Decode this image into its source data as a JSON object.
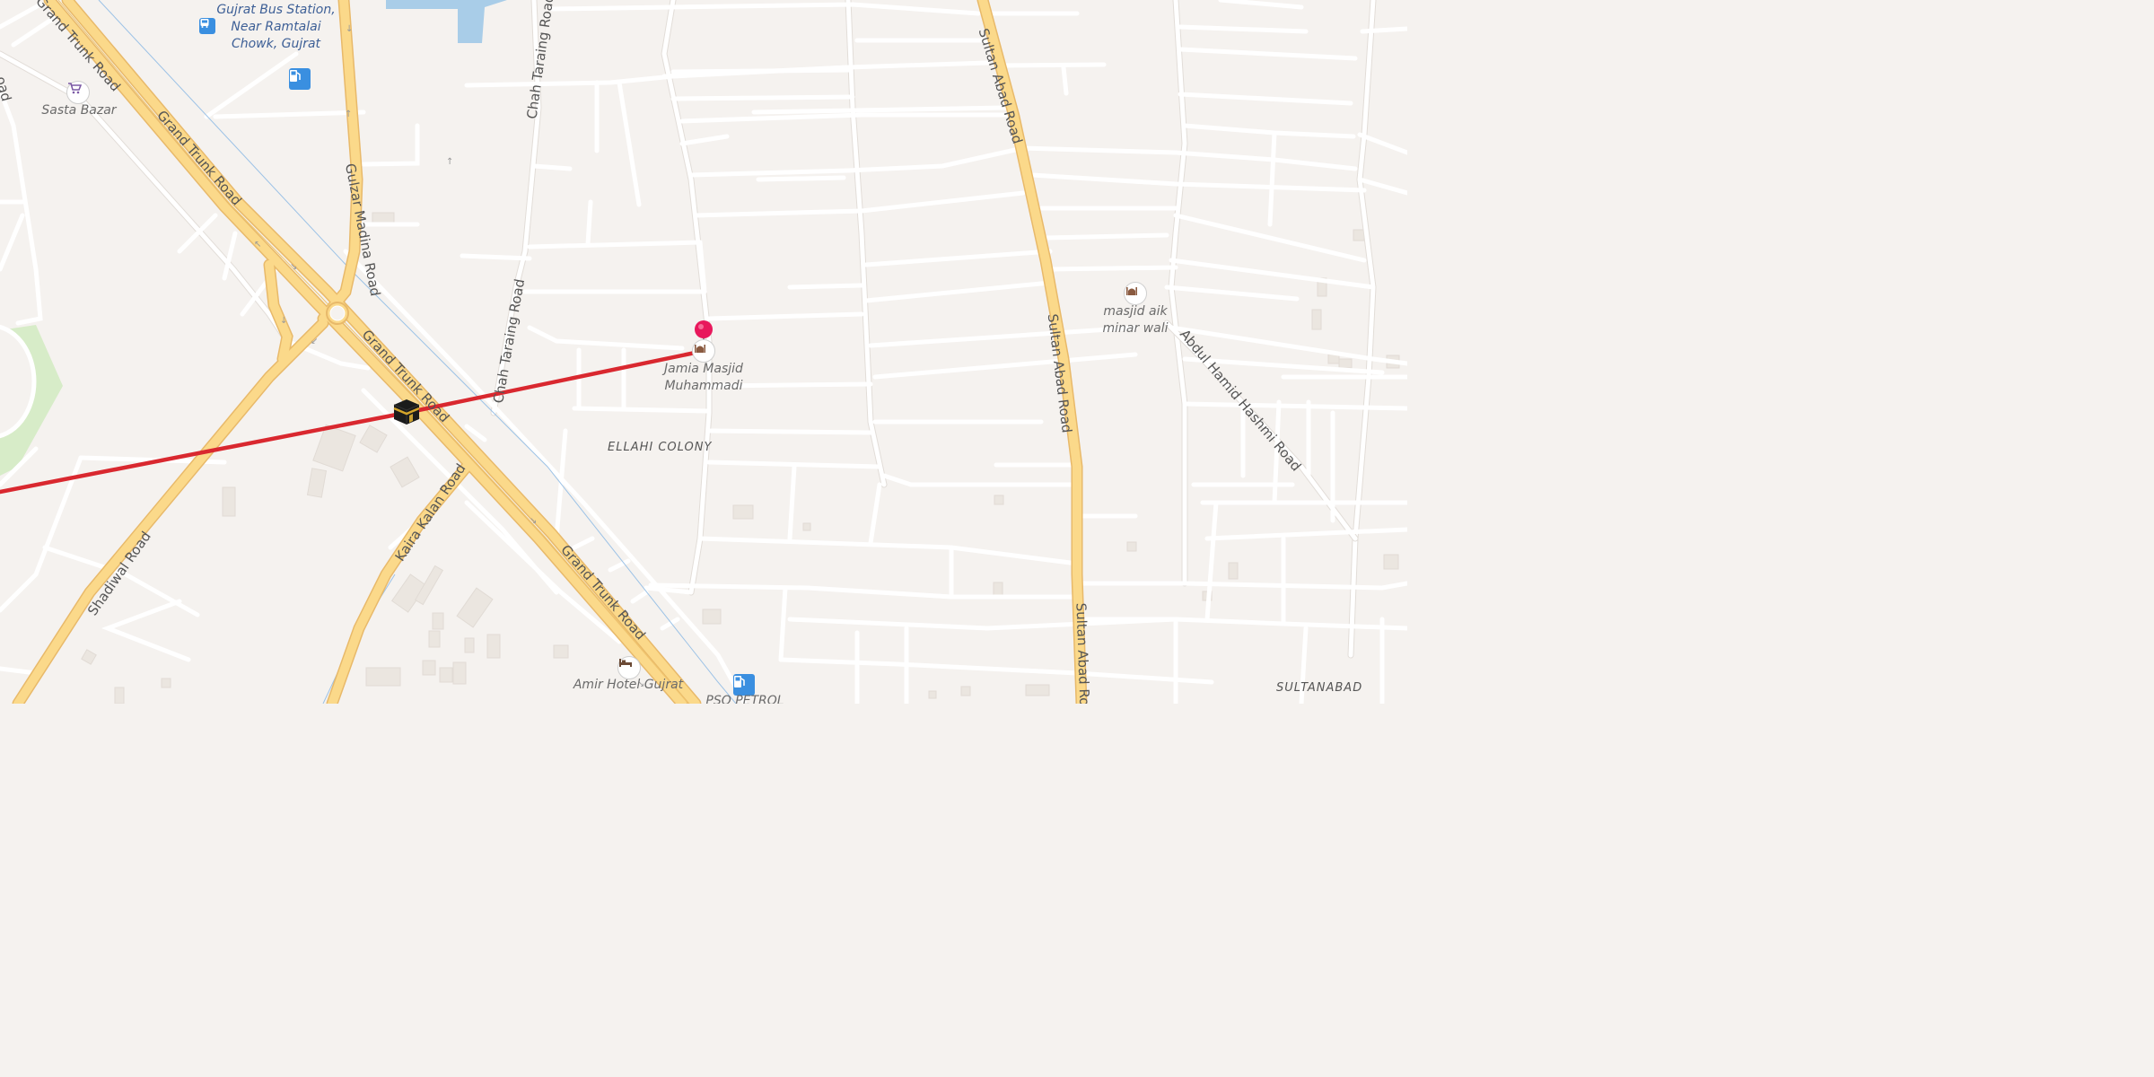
{
  "map": {
    "colors": {
      "background": "#f5f2ef",
      "major_road": "#fbd98a",
      "minor_road": "#ffffff",
      "route_line": "#d9282f",
      "pin": "#e8185c",
      "water": "#a9cde8",
      "park": "#d7ecc8",
      "poi_blue": "#3a8fe0"
    },
    "road_labels": {
      "grand_trunk_1": "Grand Trunk Road",
      "grand_trunk_2": "Grand Trunk Road",
      "grand_trunk_3": "Grand Trunk Road",
      "grand_trunk_4": "Grand Trunk Road",
      "gulzar_madina": "Gulzar Madina Road",
      "chah_taraing_1": "Chah Taraing Road",
      "chah_taraing_2": "Chah Taraing Road",
      "sultan_abad_1": "Sultan Abad Road",
      "sultan_abad_2": "Sultan Abad Road",
      "sultan_abad_3": "Sultan Abad Ro",
      "kaira_kalan": "Kaira Kalan Road",
      "shadiwal": "Shadiwal Road",
      "abdul_hamid": "Abdul Hamid Hashmi Road",
      "partial_left": "oad"
    },
    "pois": {
      "bus_station": "Gujrat Bus Station, Near Ramtalai Chowk, Gujrat",
      "sasta_bazar": "Sasta Bazar",
      "jamia_masjid": "Jamia Masjid Muhammadi",
      "masjid_aik": "masjid aik minar wali",
      "amir_hotel": "Amir Hotel Gujrat",
      "pso_petrol": "PSO PETROL"
    },
    "areas": {
      "ellahi_colony": "ELLAHI COLONY",
      "sultanabad": "SULTANABAD"
    },
    "icons": {
      "bus": "bus-icon",
      "fuel": "fuel-icon",
      "cart": "shopping-cart-icon",
      "mosque": "mosque-icon",
      "hotel": "bed-icon",
      "kaaba": "kaaba-icon",
      "pin": "location-pin-icon"
    }
  }
}
